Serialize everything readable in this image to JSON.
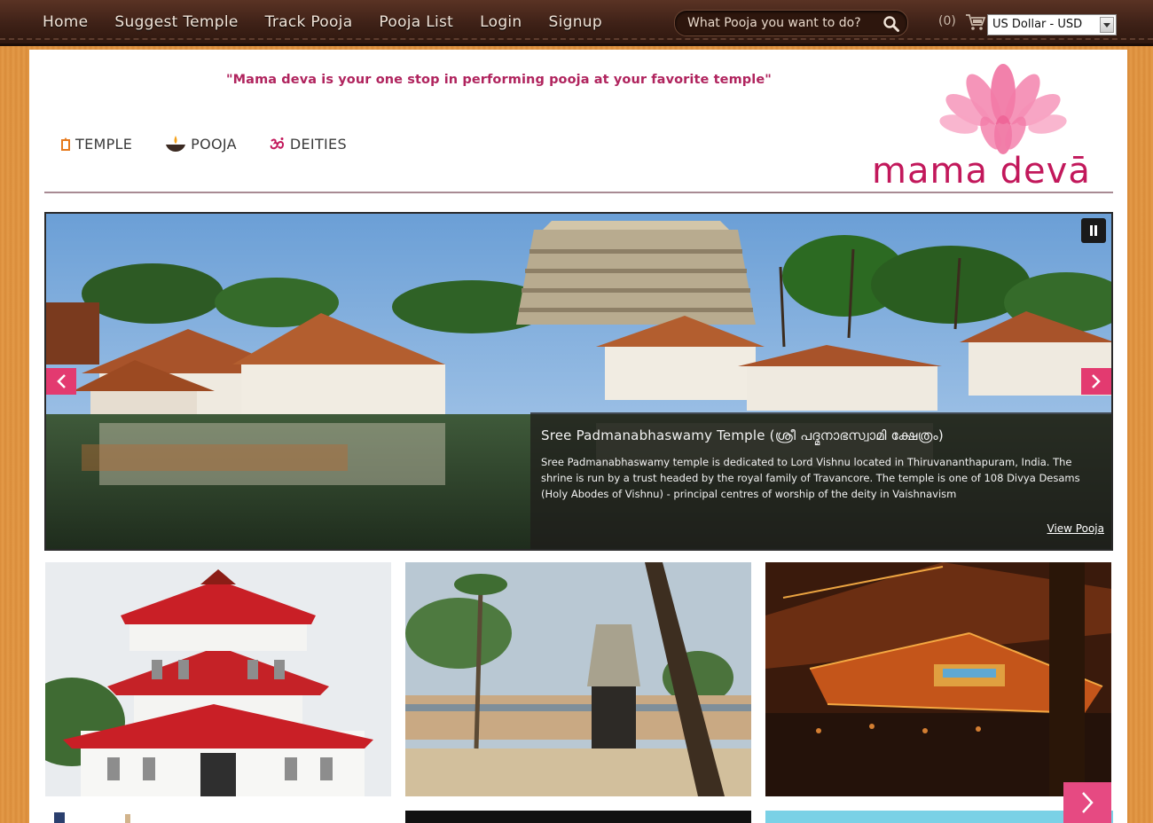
{
  "nav": {
    "items": [
      "Home",
      "Suggest Temple",
      "Track Pooja",
      "Pooja List",
      "Login",
      "Signup"
    ],
    "search_placeholder": "What Pooja you want to do?",
    "cart_count": "(0)",
    "currency_selected": "US Dollar - USD"
  },
  "header": {
    "tagline": "\"Mama deva is your one stop in performing pooja at your favorite temple\"",
    "logo_text": "mama devā",
    "categories": [
      "TEMPLE",
      "POOJA",
      "DEITIES"
    ]
  },
  "slider": {
    "title": "Sree Padmanabhaswamy Temple (ശ്രീ പദ്മനാഭസ്വാമി ക്ഷേത്രം)",
    "description": "Sree Padmanabhaswamy temple is dedicated to Lord Vishnu located in Thiruvananthapuram, India. The shrine is run by a trust headed by the royal family of Travancore. The temple is one of 108 Divya Desams (Holy Abodes of Vishnu) - principal centres of worship of the deity in Vaishnavism",
    "link_label": "View Pooja"
  },
  "colors": {
    "nav_bg": "#3e2117",
    "accent_pink": "#c2185b",
    "arrow_pink": "#e33a70",
    "page_orange": "#d98c3a"
  },
  "icons": [
    "search-icon",
    "cart-icon",
    "temple-icon",
    "lamp-icon",
    "om-icon",
    "pause-icon",
    "chevron-left-icon",
    "chevron-right-icon"
  ]
}
